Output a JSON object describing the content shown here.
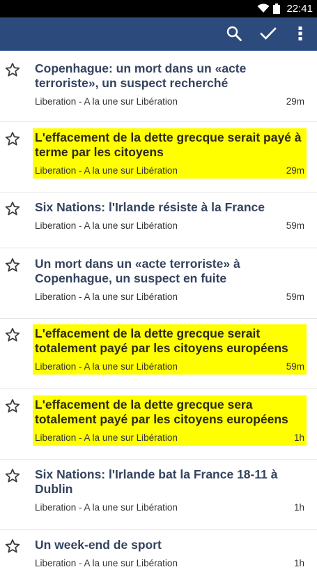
{
  "status_bar": {
    "time": "22:41",
    "icons": [
      "wifi-icon",
      "battery-icon"
    ]
  },
  "toolbar": {
    "background": "#2d4a7c",
    "actions": [
      "search-icon",
      "check-icon",
      "overflow-menu-icon"
    ]
  },
  "articles": [
    {
      "title": "Copenhague: un mort dans un «acte terroriste», un suspect recherché",
      "source": "Liberation - A la une sur Libération",
      "age": "29m",
      "highlighted": false
    },
    {
      "title": "L'effacement de la dette grecque serait payé à terme par les citoyens",
      "source": "Liberation - A la une sur Libération",
      "age": "29m",
      "highlighted": true
    },
    {
      "title": "Six Nations: l'Irlande résiste à la France",
      "source": "Liberation - A la une sur Libération",
      "age": "59m",
      "highlighted": false
    },
    {
      "title": "Un mort dans un «acte terroriste» à Copenhague, un suspect en fuite",
      "source": "Liberation - A la une sur Libération",
      "age": "59m",
      "highlighted": false
    },
    {
      "title": "L'effacement de la dette grecque serait totalement payé par les citoyens européens",
      "source": "Liberation - A la une sur Libération",
      "age": "59m",
      "highlighted": true
    },
    {
      "title": "L'effacement de la dette grecque sera totalement payé par les citoyens européens",
      "source": "Liberation - A la une sur Libération",
      "age": "1h",
      "highlighted": true
    },
    {
      "title": "Six Nations: l'Irlande bat la France 18-11 à Dublin",
      "source": "Liberation - A la une sur Libération",
      "age": "1h",
      "highlighted": false
    },
    {
      "title": "Un week-end de sport",
      "source": "Liberation - A la une sur Libération",
      "age": "1h",
      "highlighted": false
    }
  ],
  "colors": {
    "highlight": "#ffff00",
    "title_text": "#34435e",
    "meta_text": "#333333"
  }
}
